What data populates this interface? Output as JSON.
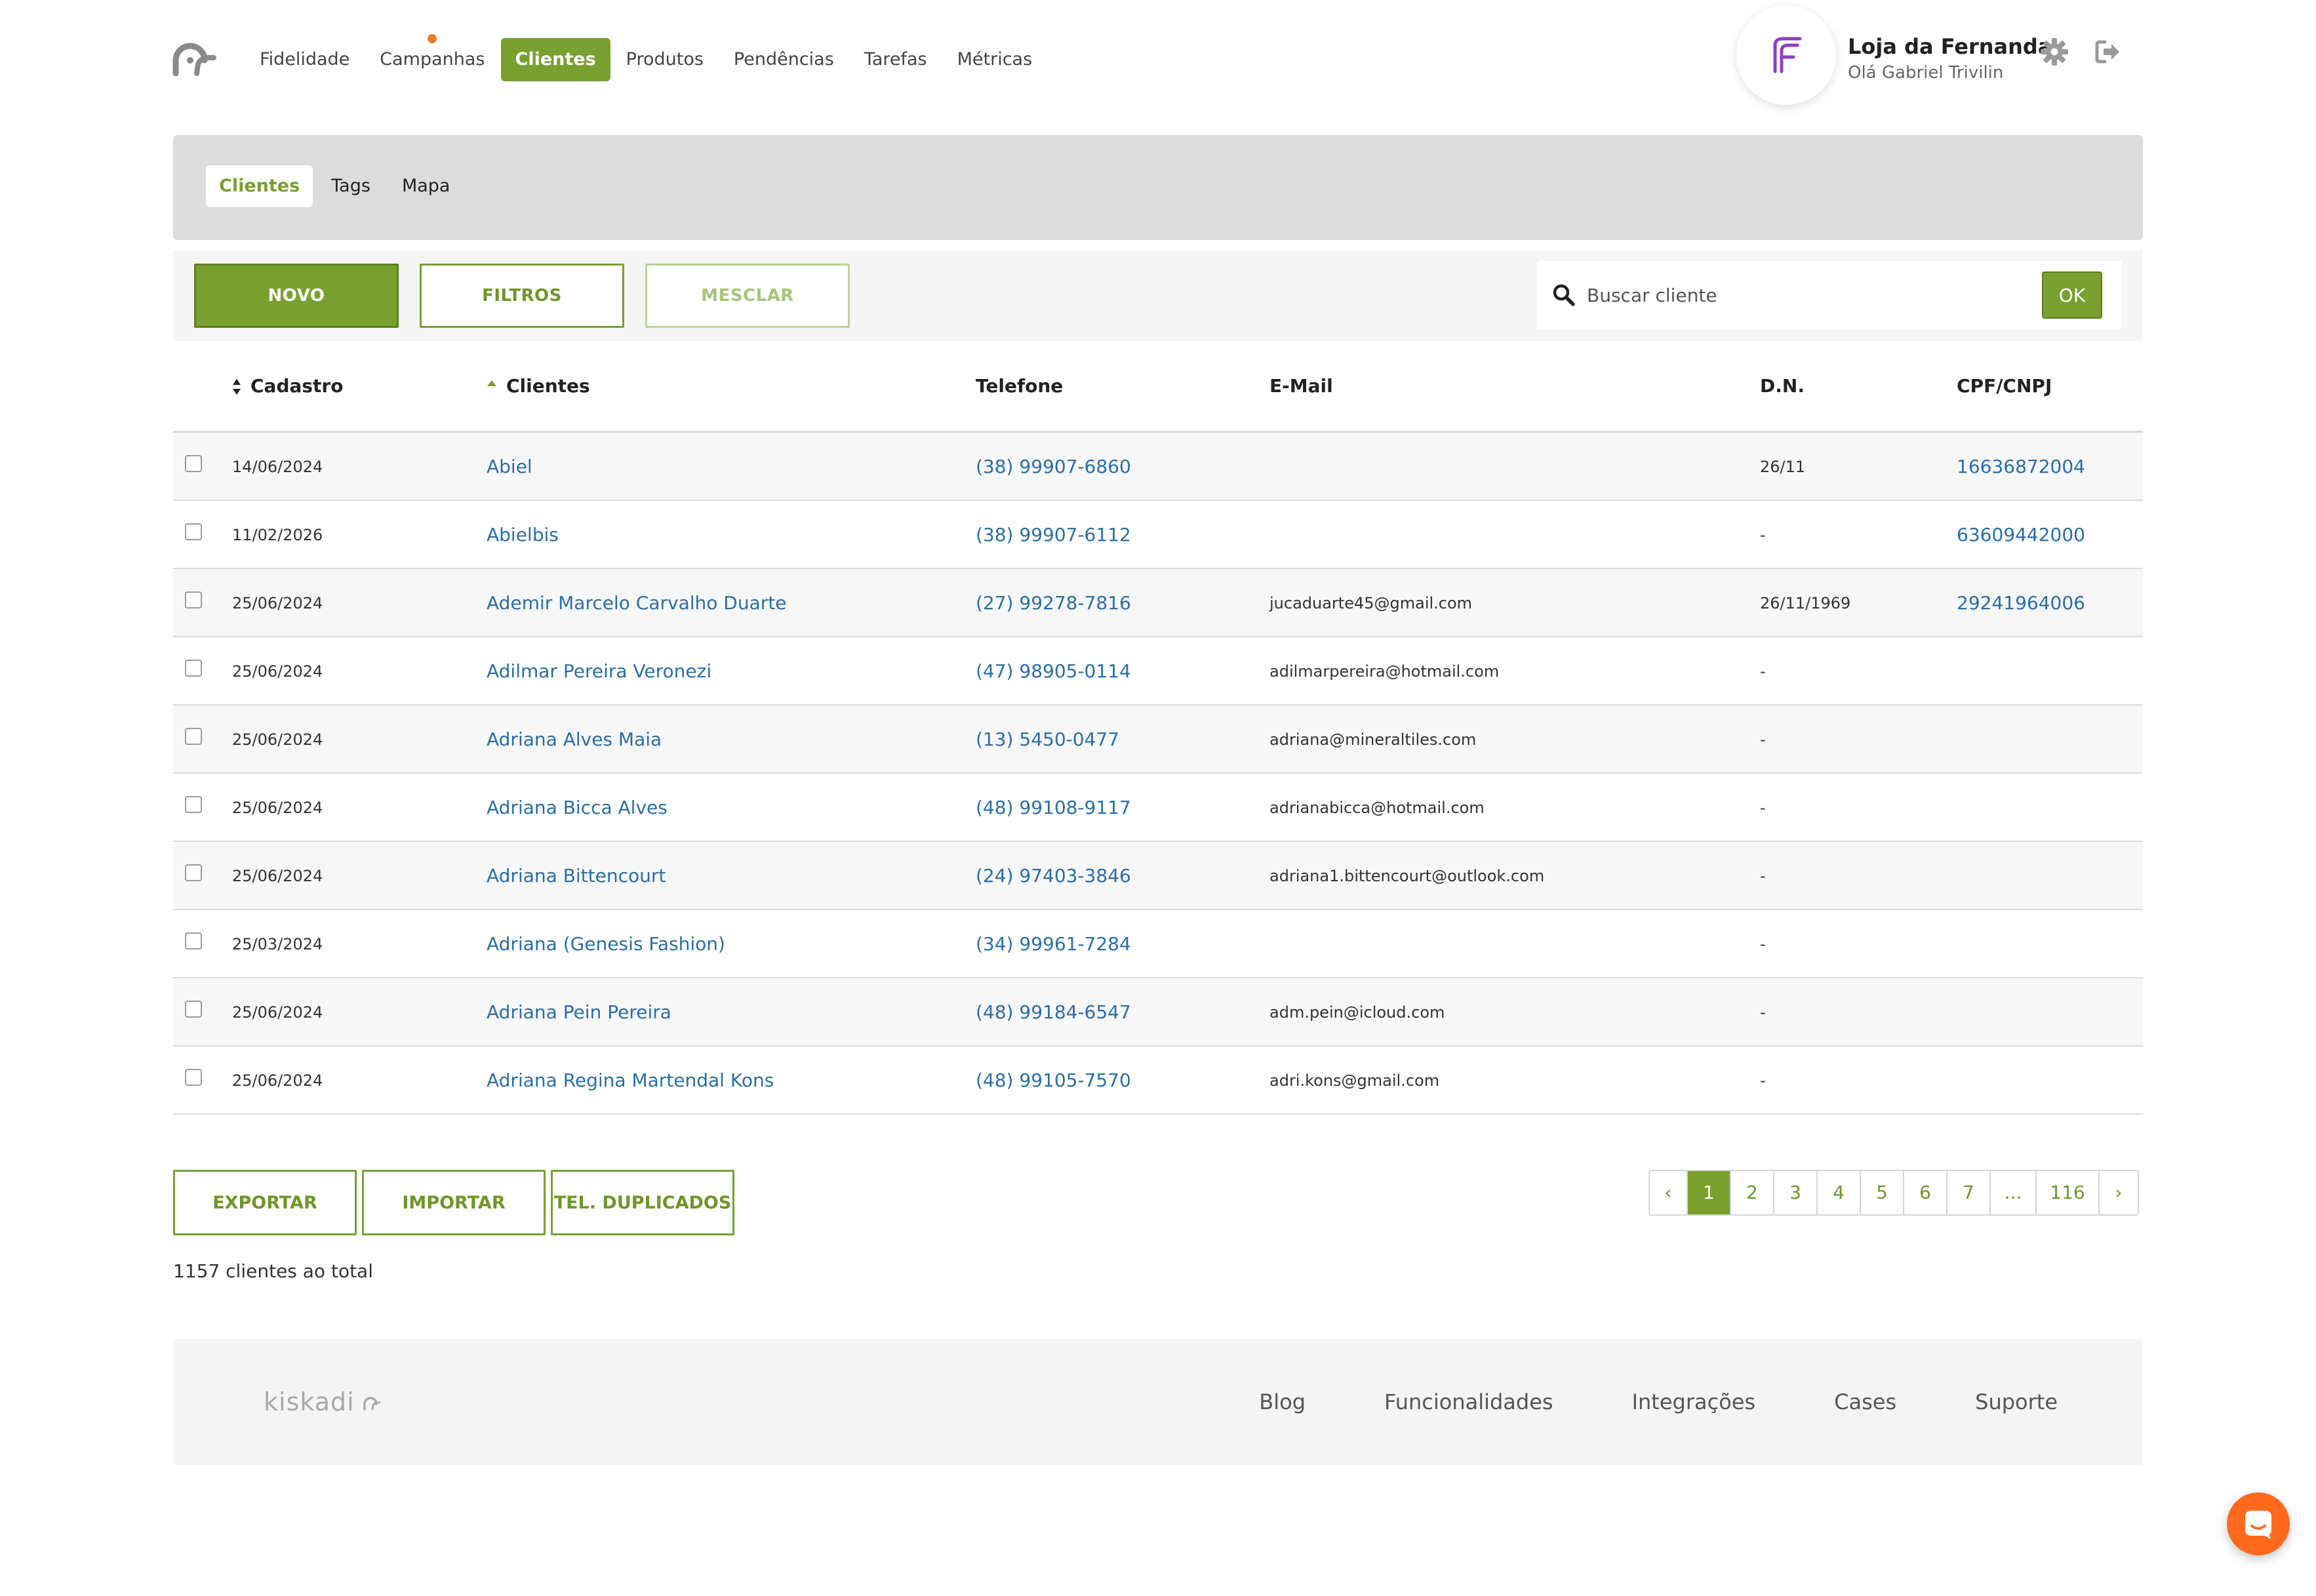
{
  "nav": {
    "items": [
      {
        "label": "Fidelidade",
        "active": false,
        "dot": false
      },
      {
        "label": "Campanhas",
        "active": false,
        "dot": true
      },
      {
        "label": "Clientes",
        "active": true,
        "dot": false
      },
      {
        "label": "Produtos",
        "active": false,
        "dot": false
      },
      {
        "label": "Pendências",
        "active": false,
        "dot": false
      },
      {
        "label": "Tarefas",
        "active": false,
        "dot": false
      },
      {
        "label": "Métricas",
        "active": false,
        "dot": false
      }
    ]
  },
  "store": {
    "name": "Loja da Fernanda",
    "greeting": "Olá Gabriel Trivilin"
  },
  "subnav": {
    "tabs": [
      {
        "label": "Clientes",
        "active": true
      },
      {
        "label": "Tags",
        "active": false
      },
      {
        "label": "Mapa",
        "active": false
      }
    ]
  },
  "toolbar": {
    "novo_label": "Novo",
    "filtros_label": "Filtros",
    "mesclar_label": "Mesclar",
    "search_placeholder": "Buscar cliente",
    "ok_label": "OK"
  },
  "table": {
    "headers": {
      "cadastro": "Cadastro",
      "clientes": "Clientes",
      "telefone": "Telefone",
      "email": "E-Mail",
      "dn": "D.N.",
      "cpf": "CPF/CNPJ"
    },
    "rows": [
      {
        "date": "14/06/2024",
        "name": "Abiel",
        "phone": "(38) 99907-6860",
        "email": "",
        "dn": "26/11",
        "cpf": "16636872004"
      },
      {
        "date": "11/02/2026",
        "name": "Abielbis",
        "phone": "(38) 99907-6112",
        "email": "",
        "dn": "-",
        "cpf": "63609442000"
      },
      {
        "date": "25/06/2024",
        "name": "Ademir Marcelo Carvalho Duarte",
        "phone": "(27) 99278-7816",
        "email": "jucaduarte45@gmail.com",
        "dn": "26/11/1969",
        "cpf": "29241964006"
      },
      {
        "date": "25/06/2024",
        "name": "Adilmar Pereira Veronezi",
        "phone": "(47) 98905-0114",
        "email": "adilmarpereira@hotmail.com",
        "dn": "-",
        "cpf": ""
      },
      {
        "date": "25/06/2024",
        "name": "Adriana Alves Maia",
        "phone": "(13) 5450-0477",
        "email": "adriana@mineraltiles.com",
        "dn": "-",
        "cpf": ""
      },
      {
        "date": "25/06/2024",
        "name": "Adriana Bicca Alves",
        "phone": "(48) 99108-9117",
        "email": "adrianabicca@hotmail.com",
        "dn": "-",
        "cpf": ""
      },
      {
        "date": "25/06/2024",
        "name": "Adriana Bittencourt",
        "phone": "(24) 97403-3846",
        "email": "adriana1.bittencourt@outlook.com",
        "dn": "-",
        "cpf": ""
      },
      {
        "date": "25/03/2024",
        "name": "Adriana (Genesis Fashion)",
        "phone": "(34) 99961-7284",
        "email": "",
        "dn": "-",
        "cpf": ""
      },
      {
        "date": "25/06/2024",
        "name": "Adriana Pein Pereira",
        "phone": "(48) 99184-6547",
        "email": "adm.pein@icloud.com",
        "dn": "-",
        "cpf": ""
      },
      {
        "date": "25/06/2024",
        "name": "Adriana Regina Martendal Kons",
        "phone": "(48) 99105-7570",
        "email": "adri.kons@gmail.com",
        "dn": "-",
        "cpf": ""
      }
    ]
  },
  "actions": {
    "exportar_label": "Exportar",
    "importar_label": "Importar",
    "duplicados_label": "Tel. duplicados"
  },
  "summary": {
    "total_text": "1157 clientes ao total"
  },
  "pagination": {
    "prev": "‹",
    "next": "›",
    "pages": [
      "1",
      "2",
      "3",
      "4",
      "5",
      "6",
      "7",
      "...",
      "116"
    ],
    "current": "1"
  },
  "footer": {
    "logo_text": "kiskadi",
    "links": [
      "Blog",
      "Funcionalidades",
      "Integrações",
      "Cases",
      "Suporte"
    ]
  },
  "colors": {
    "accent": "#79a02f",
    "link": "#2a6ea8",
    "notification_dot": "#ee7e2e",
    "chat": "#ff6a1f",
    "store_logo": "#8e3fc4"
  },
  "icons": {
    "brand": "bird-logo-icon",
    "settings": "gear-icon",
    "logout": "logout-icon",
    "search": "search-icon",
    "sort": "sort-icon",
    "chat": "chat-icon"
  }
}
